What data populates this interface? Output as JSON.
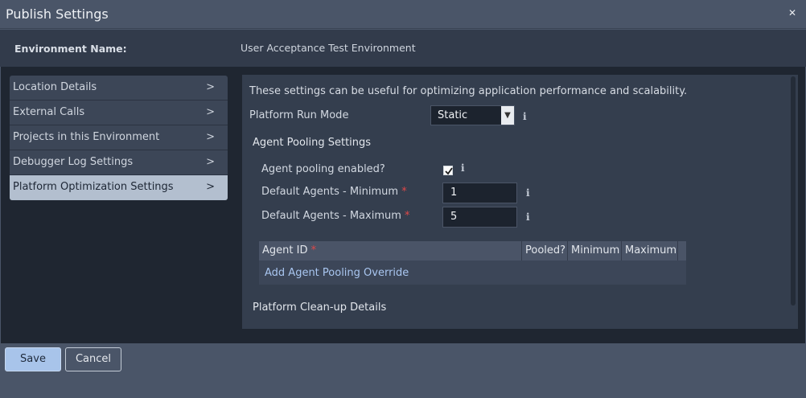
{
  "dialog": {
    "title": "Publish Settings",
    "close_icon": "close-icon"
  },
  "environment": {
    "label": "Environment Name:",
    "value": "User Acceptance Test Environment"
  },
  "sidebar": {
    "items": [
      {
        "label": "Location Details",
        "active": false
      },
      {
        "label": "External Calls",
        "active": false
      },
      {
        "label": "Projects in this Environment",
        "active": false
      },
      {
        "label": "Debugger Log Settings",
        "active": false
      },
      {
        "label": "Platform Optimization Settings",
        "active": true
      }
    ],
    "chevron": ">"
  },
  "content": {
    "intro": "These settings can be useful for optimizing application performance and scalability.",
    "run_mode": {
      "label": "Platform Run Mode",
      "value": "Static"
    },
    "agent_pooling": {
      "title": "Agent Pooling Settings",
      "enabled_label": "Agent pooling enabled?",
      "enabled": true,
      "min_label": "Default Agents - Minimum",
      "min_value": "1",
      "max_label": "Default Agents - Maximum",
      "max_value": "5",
      "required_mark": "*"
    },
    "table": {
      "columns": [
        "Agent ID",
        "Pooled?",
        "Minimum",
        "Maximum"
      ],
      "required_mark": "*",
      "add_link": "Add Agent Pooling Override"
    },
    "cleanup": {
      "title": "Platform Clean-up Details"
    },
    "info_glyph": "i"
  },
  "footer": {
    "save_label": "Save",
    "cancel_label": "Cancel"
  },
  "colors": {
    "accent": "#a8c4ea",
    "link": "#a9c6f0",
    "required": "#e04848"
  }
}
